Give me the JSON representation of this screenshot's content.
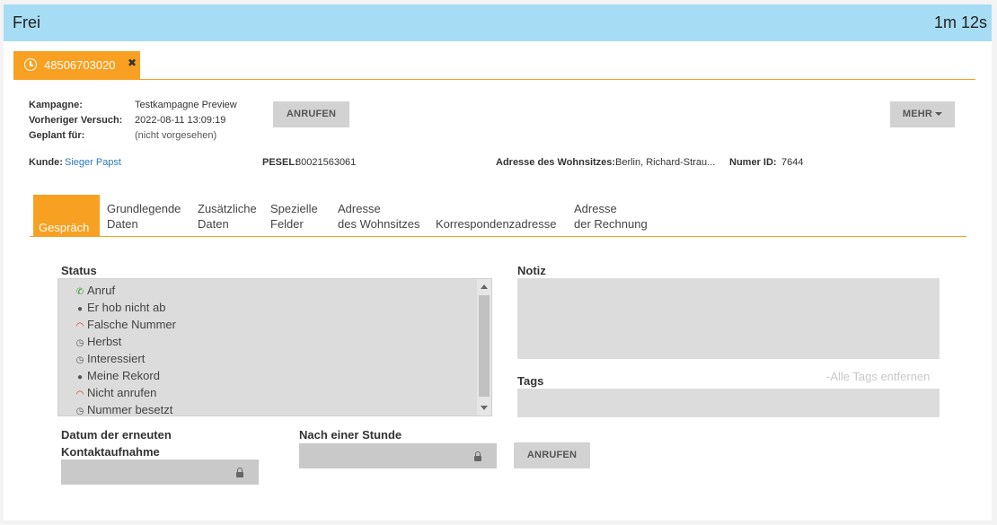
{
  "topbar": {
    "status": "Frei",
    "timer": "1m 12s",
    "color": "#a6dcf4"
  },
  "call_tab": {
    "number": "48506703020",
    "close": "✖",
    "color": "#f8a021"
  },
  "info": {
    "kampagne_label": "Kampagne:",
    "kampagne_value": "Testkampagne Preview",
    "versuch_label": "Vorheriger Versuch:",
    "versuch_value": "2022-08-11 13:09:19",
    "geplant_label": "Geplant für:",
    "geplant_value": "(nicht vorgesehen)",
    "kunde_label": "Kunde:",
    "kunde_value": "Sieger Papst",
    "pesel_label": "PESEL:",
    "pesel_value": "80021563061",
    "adresse_label": "Adresse des Wohnsitzes:",
    "adresse_value": "Berlin, Richard-Strau...",
    "numer_label": "Numer ID:",
    "numer_value": "7644"
  },
  "buttons": {
    "anrufen": "ANRUFEN",
    "mehr": "MEHR",
    "anrufen_bottom": "ANRUFEN"
  },
  "tabs": [
    {
      "line1": "Gespräch",
      "line2": ""
    },
    {
      "line1": "Grundlegende",
      "line2": "Daten"
    },
    {
      "line1": "Zusätzliche",
      "line2": "Daten"
    },
    {
      "line1": "Spezielle",
      "line2": "Felder"
    },
    {
      "line1": "Adresse",
      "line2": "des Wohnsitzes"
    },
    {
      "line1": "",
      "line2": "Korrespondenzadresse"
    },
    {
      "line1": "Adresse",
      "line2": "der Rechnung"
    }
  ],
  "status_section": {
    "label": "Status",
    "items": [
      {
        "label": "Anruf",
        "icon": "phone-green-icon"
      },
      {
        "label": "Er hob nicht ab",
        "icon": "user-icon"
      },
      {
        "label": "Falsche Nummer",
        "icon": "hangup-red-icon"
      },
      {
        "label": "Herbst",
        "icon": "clock-icon"
      },
      {
        "label": "Interessiert",
        "icon": "clock-icon"
      },
      {
        "label": "Meine Rekord",
        "icon": "user-icon"
      },
      {
        "label": "Nicht anrufen",
        "icon": "hangup-red-icon"
      },
      {
        "label": "Nummer besetzt",
        "icon": "clock-icon"
      }
    ]
  },
  "notiz": {
    "label": "Notiz"
  },
  "tags": {
    "label": "Tags",
    "clear": "-Alle Tags entfernen"
  },
  "datum": {
    "label_line1": "Datum der erneuten",
    "label_line2": "Kontaktaufnahme"
  },
  "nach": {
    "label": "Nach einer Stunde"
  }
}
